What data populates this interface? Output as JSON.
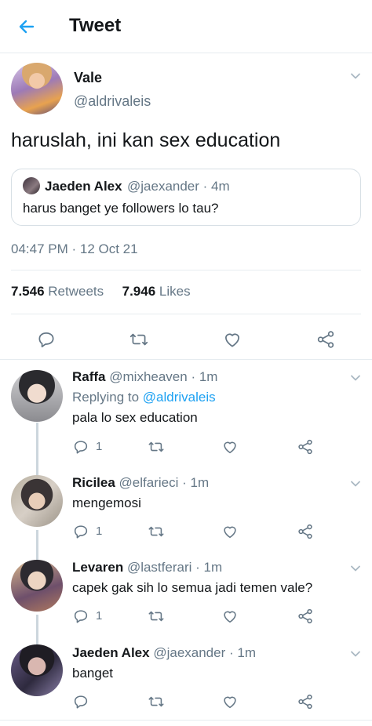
{
  "header": {
    "title": "Tweet"
  },
  "tweet": {
    "name": "Vale",
    "handle": "@aldrivaleis",
    "text": "haruslah, ini kan sex education",
    "quote": {
      "name": "Jaeden Alex",
      "meta": "@jaexander · 4m",
      "text": "harus banget ye followers lo tau?"
    },
    "timestamp": "04:47 PM · 12 Oct 21",
    "retweets_count": "7.546",
    "retweets_label": "Retweets",
    "likes_count": "7.946",
    "likes_label": "Likes"
  },
  "replies": [
    {
      "name": "Raffa",
      "meta": "@mixheaven · 1m",
      "replying_prefix": "Replying to",
      "replying_to": "@aldrivaleis",
      "text": "pala lo sex education",
      "reply_count": "1"
    },
    {
      "name": "Ricilea",
      "meta": "@elfarieci · 1m",
      "text": "mengemosi",
      "reply_count": "1"
    },
    {
      "name": "Levaren",
      "meta": "@lastferari · 1m",
      "text": "capek gak sih lo semua jadi temen vale?",
      "reply_count": "1"
    },
    {
      "name": "Jaeden Alex",
      "meta": "@jaexander · 1m",
      "text": "banget",
      "reply_count": ""
    }
  ],
  "colors": {
    "accent": "#1da1f2",
    "muted": "#657786",
    "icon": "#657786"
  }
}
